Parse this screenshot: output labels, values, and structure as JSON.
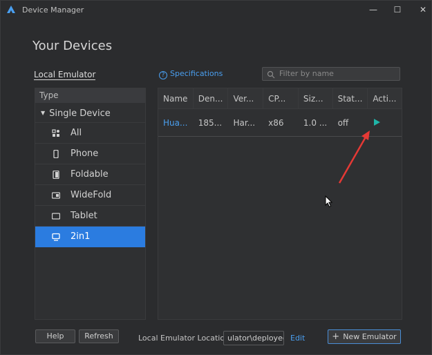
{
  "window": {
    "title": "Device Manager",
    "controls": {
      "minimize": "—",
      "maximize": "☐",
      "close": "✕"
    }
  },
  "page": {
    "heading": "Your Devices",
    "tab_local": "Local Emulator"
  },
  "sidebar": {
    "header": "Type",
    "group": "Single Device",
    "items": [
      {
        "label": "All",
        "icon": "grid-icon",
        "selected": false
      },
      {
        "label": "Phone",
        "icon": "phone-icon",
        "selected": false
      },
      {
        "label": "Foldable",
        "icon": "foldable-icon",
        "selected": false
      },
      {
        "label": "WideFold",
        "icon": "widefold-icon",
        "selected": false
      },
      {
        "label": "Tablet",
        "icon": "tablet-icon",
        "selected": false
      },
      {
        "label": "2in1",
        "icon": "laptop-icon",
        "selected": true
      }
    ]
  },
  "toolbar": {
    "specifications": "Specifications",
    "filter_placeholder": "Filter by name"
  },
  "table": {
    "columns": [
      "Name",
      "Den...",
      "Ver...",
      "CP...",
      "Siz...",
      "Stat...",
      "Acti..."
    ],
    "rows": [
      {
        "name": "Hua...",
        "density": "185...",
        "version": "Har...",
        "cpu": "x86",
        "size": "1.0 ...",
        "status": "off",
        "action": "play-icon"
      }
    ]
  },
  "footer": {
    "help": "Help",
    "refresh": "Refresh",
    "location_label": "Local Emulator Location:",
    "location_value": "ulator\\deployed",
    "edit": "Edit",
    "new_emulator": "New Emulator"
  },
  "colors": {
    "accent": "#2b7ce0",
    "link": "#4a9ff0",
    "play": "#1fb5a8",
    "annotation_arrow": "#e53935"
  }
}
